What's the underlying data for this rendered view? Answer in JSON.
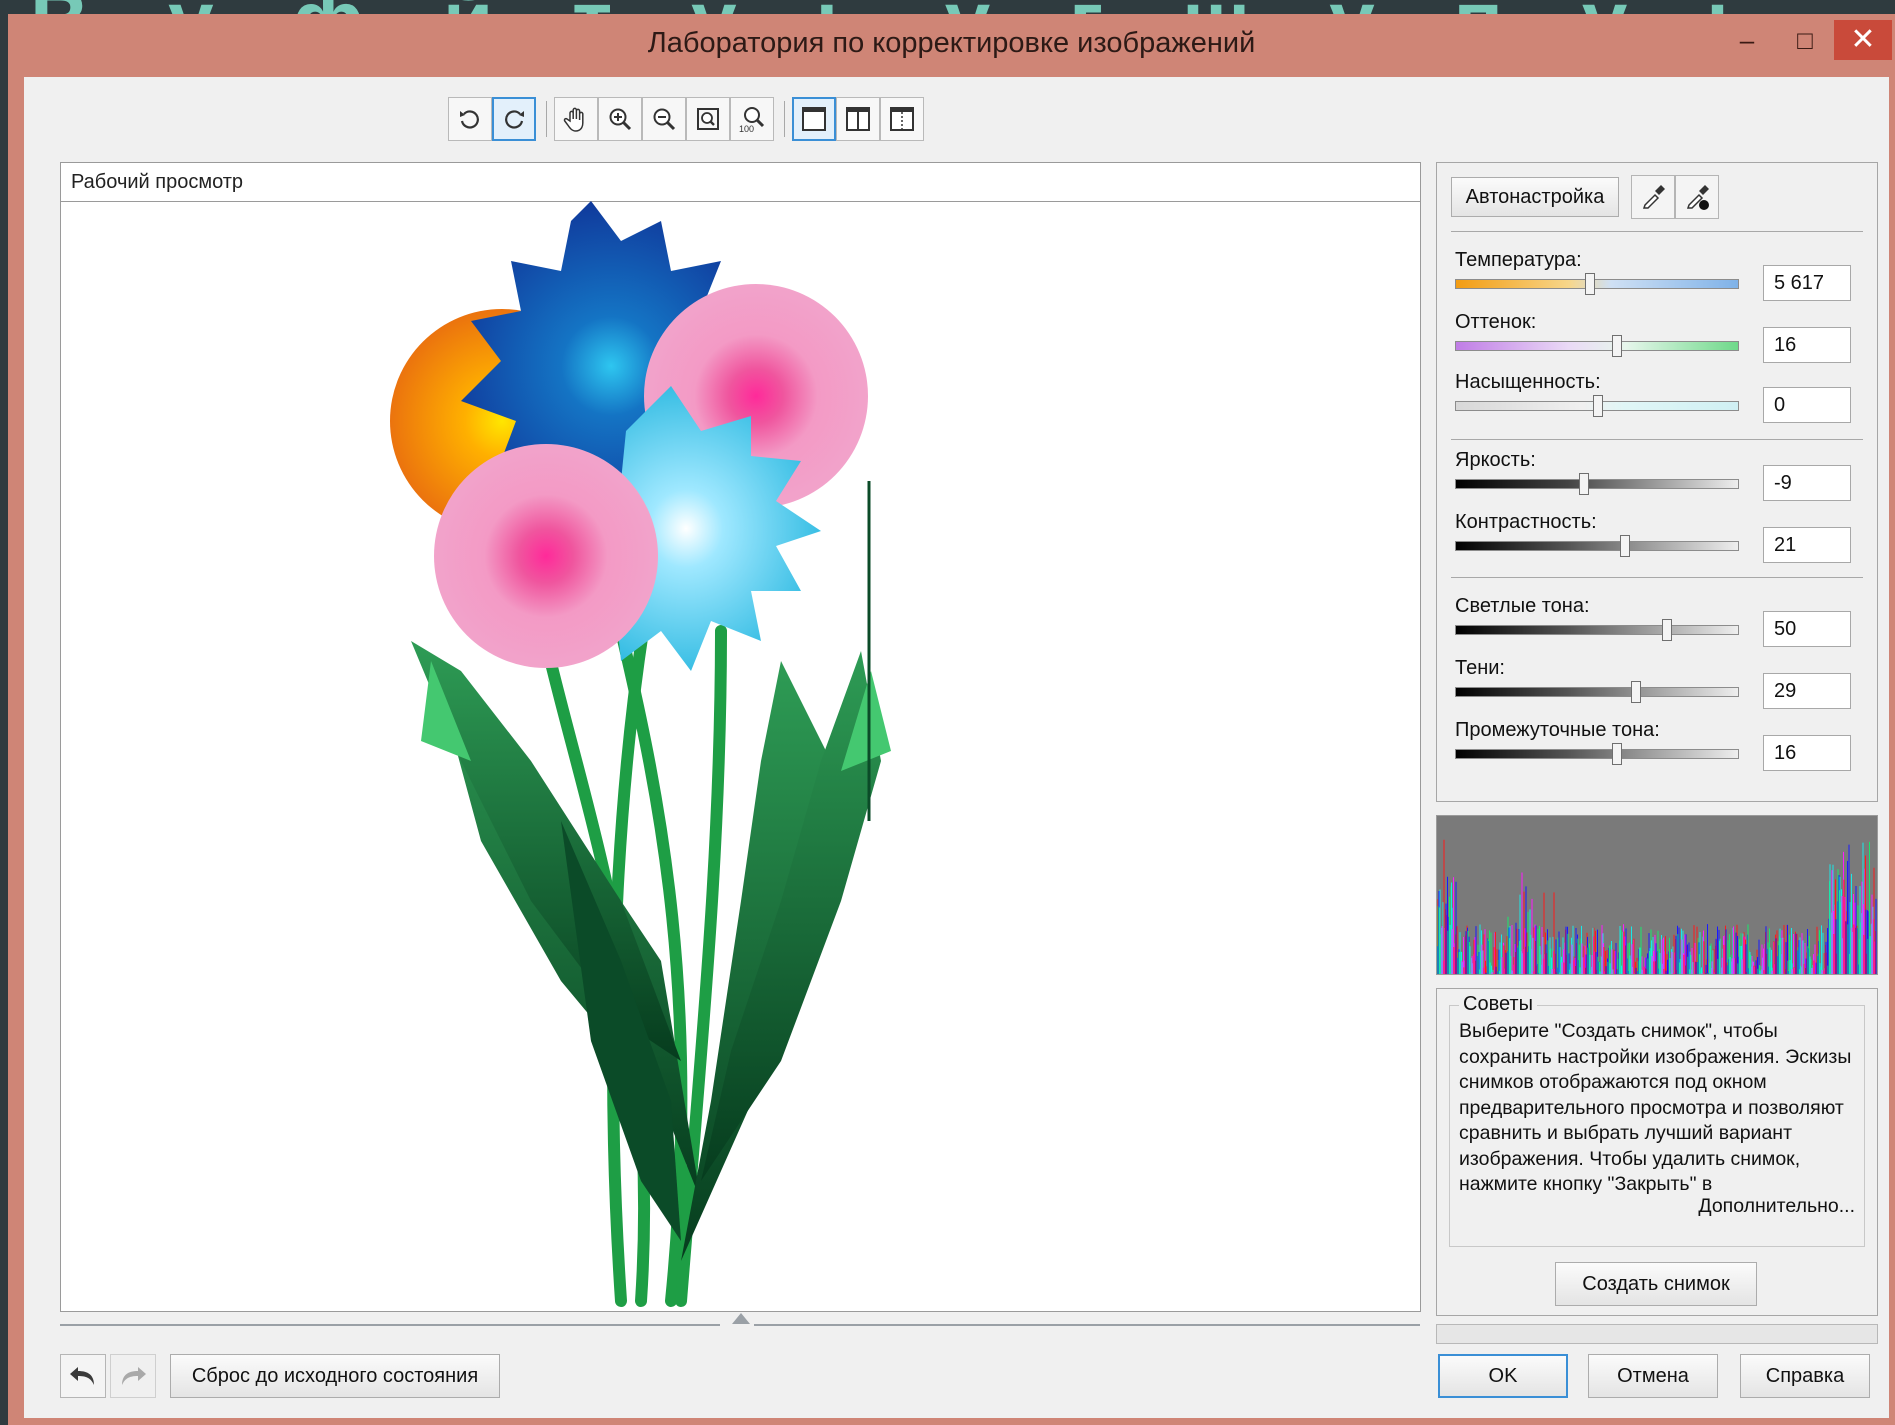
{
  "background_text": "В  у  ф  й  т  у  ь  у  г  ш  у  п  у  ь",
  "window": {
    "title": "Лаборатория по корректировке изображений",
    "minimize": "–",
    "maximize": "□",
    "close": "✕"
  },
  "toolbar": {
    "buttons": [
      {
        "name": "rotate-left-icon"
      },
      {
        "name": "rotate-right-icon",
        "active": true
      },
      {
        "name": "pan-hand-icon"
      },
      {
        "name": "zoom-in-icon"
      },
      {
        "name": "zoom-out-icon"
      },
      {
        "name": "fit-window-icon"
      },
      {
        "name": "zoom-100-icon"
      },
      {
        "name": "single-view-icon",
        "active": true
      },
      {
        "name": "split-view-vertical-icon"
      },
      {
        "name": "split-view-dual-icon"
      }
    ]
  },
  "preview": {
    "header": "Рабочий просмотр"
  },
  "panel": {
    "auto_button": "Автонастройка",
    "sliders": [
      {
        "label": "Температура:",
        "value": "5 617",
        "fraction": 0.47
      },
      {
        "label": "Оттенок:",
        "value": "16",
        "fraction": 0.57
      },
      {
        "label": "Насыщенность:",
        "value": "0",
        "fraction": 0.5
      },
      {
        "label": "Яркость:",
        "value": "-9",
        "fraction": 0.45
      },
      {
        "label": "Контрастность:",
        "value": "21",
        "fraction": 0.6
      },
      {
        "label": "Светлые тона:",
        "value": "50",
        "fraction": 0.75
      },
      {
        "label": "Тени:",
        "value": "29",
        "fraction": 0.64
      },
      {
        "label": "Промежуточные тона:",
        "value": "16",
        "fraction": 0.57
      }
    ]
  },
  "tips": {
    "title": "Советы",
    "text": "Выберите \"Создать снимок\", чтобы сохранить настройки изображения. Эскизы снимков отображаются под окном предварительного просмотра и позволяют сравнить и выбрать лучший вариант изображения. Чтобы удалить снимок, нажмите кнопку \"Закрыть\" в",
    "more": "Дополнительно...",
    "snapshot_button": "Создать снимок"
  },
  "footer": {
    "reset": "Сброс до исходного состояния",
    "ok": "OK",
    "cancel": "Отмена",
    "help": "Справка"
  },
  "colors": {
    "titlebar": "#cf8576",
    "close": "#c94a3a",
    "accent": "#3a8fd6"
  }
}
